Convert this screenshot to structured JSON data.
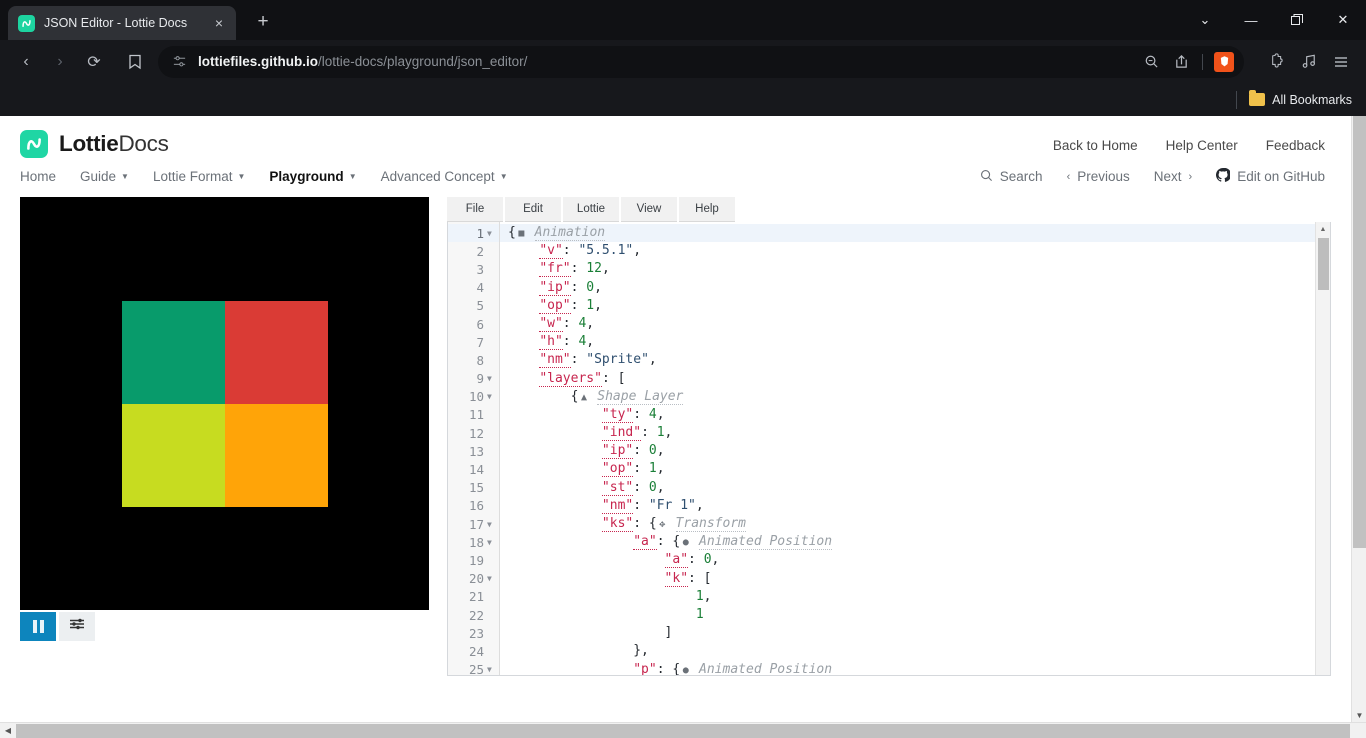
{
  "browser": {
    "name": "Brave",
    "tab": {
      "title": "JSON Editor - Lottie Docs",
      "favicon": "lottie-logo-icon",
      "close": "×"
    },
    "new_tab_label": "+",
    "window_controls": {
      "minimize": "—",
      "maximize": "❐",
      "close": "✕",
      "tab_search": "⌄"
    },
    "nav": {
      "back": "‹",
      "forward": "›",
      "reload": "⟳",
      "bookmark": "☆"
    },
    "url": {
      "domain": "lottiefiles.github.io",
      "path": "/lottie-docs/playground/json_editor/"
    },
    "url_actions": {
      "zoom_out": "zoom-out-icon",
      "share": "share-icon",
      "shield": "brave-shields-icon",
      "shield_glyph": "🦁"
    },
    "toolbar_right": {
      "extensions": "extensions-icon",
      "music": "music-icon",
      "menu": "hamburger-menu-icon"
    },
    "bookmarks_bar": {
      "all_bookmarks": "All Bookmarks"
    }
  },
  "site": {
    "logo": {
      "bold": "Lottie",
      "normal": "Docs"
    },
    "header_links": [
      "Back to Home",
      "Help Center",
      "Feedback"
    ],
    "nav_left": [
      {
        "label": "Home",
        "caret": false,
        "active": false
      },
      {
        "label": "Guide",
        "caret": true,
        "active": false
      },
      {
        "label": "Lottie Format",
        "caret": true,
        "active": false
      },
      {
        "label": "Playground",
        "caret": true,
        "active": true
      },
      {
        "label": "Advanced Concept",
        "caret": true,
        "active": false
      }
    ],
    "nav_right": [
      {
        "label": "Search",
        "icon": "search-icon"
      },
      {
        "label": "Previous",
        "icon": "chevron-left-icon"
      },
      {
        "label": "Next",
        "icon": "chevron-right-icon"
      },
      {
        "label": "Edit on GitHub",
        "icon": "github-icon"
      }
    ]
  },
  "preview": {
    "background": "#000000",
    "quadrants": [
      {
        "name": "top-left",
        "color": "#089b6b"
      },
      {
        "name": "top-right",
        "color": "#da3b35"
      },
      {
        "name": "bottom-left",
        "color": "#c7dc20"
      },
      {
        "name": "bottom-right",
        "color": "#ffa408"
      }
    ],
    "controls": {
      "pause": {
        "name": "pause-button",
        "color": "#0d85bd"
      },
      "settings": {
        "name": "playback-settings-button",
        "glyph": "☲"
      }
    }
  },
  "editor": {
    "menus": [
      "File",
      "Edit",
      "Lottie",
      "View",
      "Help"
    ],
    "active_line": 1,
    "lines": [
      {
        "n": 1,
        "fold": true,
        "indent": 0,
        "tokens": [
          {
            "t": "p",
            "v": "{"
          },
          {
            "t": "badge",
            "v": "■"
          },
          {
            "t": "lbl",
            "v": "Animation"
          }
        ]
      },
      {
        "n": 2,
        "fold": false,
        "indent": 1,
        "tokens": [
          {
            "t": "k",
            "v": "\"v\""
          },
          {
            "t": "p",
            "v": ": "
          },
          {
            "t": "s",
            "v": "\"5.5.1\""
          },
          {
            "t": "p",
            "v": ","
          }
        ]
      },
      {
        "n": 3,
        "fold": false,
        "indent": 1,
        "tokens": [
          {
            "t": "k",
            "v": "\"fr\""
          },
          {
            "t": "p",
            "v": ": "
          },
          {
            "t": "n",
            "v": "12"
          },
          {
            "t": "p",
            "v": ","
          }
        ]
      },
      {
        "n": 4,
        "fold": false,
        "indent": 1,
        "tokens": [
          {
            "t": "k",
            "v": "\"ip\""
          },
          {
            "t": "p",
            "v": ": "
          },
          {
            "t": "n",
            "v": "0"
          },
          {
            "t": "p",
            "v": ","
          }
        ]
      },
      {
        "n": 5,
        "fold": false,
        "indent": 1,
        "tokens": [
          {
            "t": "k",
            "v": "\"op\""
          },
          {
            "t": "p",
            "v": ": "
          },
          {
            "t": "n",
            "v": "1"
          },
          {
            "t": "p",
            "v": ","
          }
        ]
      },
      {
        "n": 6,
        "fold": false,
        "indent": 1,
        "tokens": [
          {
            "t": "k",
            "v": "\"w\""
          },
          {
            "t": "p",
            "v": ": "
          },
          {
            "t": "n",
            "v": "4"
          },
          {
            "t": "p",
            "v": ","
          }
        ]
      },
      {
        "n": 7,
        "fold": false,
        "indent": 1,
        "tokens": [
          {
            "t": "k",
            "v": "\"h\""
          },
          {
            "t": "p",
            "v": ": "
          },
          {
            "t": "n",
            "v": "4"
          },
          {
            "t": "p",
            "v": ","
          }
        ]
      },
      {
        "n": 8,
        "fold": false,
        "indent": 1,
        "tokens": [
          {
            "t": "k",
            "v": "\"nm\""
          },
          {
            "t": "p",
            "v": ": "
          },
          {
            "t": "s",
            "v": "\"Sprite\""
          },
          {
            "t": "p",
            "v": ","
          }
        ]
      },
      {
        "n": 9,
        "fold": true,
        "indent": 1,
        "tokens": [
          {
            "t": "k",
            "v": "\"layers\""
          },
          {
            "t": "p",
            "v": ": ["
          }
        ]
      },
      {
        "n": 10,
        "fold": true,
        "indent": 2,
        "tokens": [
          {
            "t": "p",
            "v": "{"
          },
          {
            "t": "badge",
            "v": "▲"
          },
          {
            "t": "lbl",
            "v": "Shape Layer"
          }
        ]
      },
      {
        "n": 11,
        "fold": false,
        "indent": 3,
        "tokens": [
          {
            "t": "k",
            "v": "\"ty\""
          },
          {
            "t": "p",
            "v": ": "
          },
          {
            "t": "n",
            "v": "4"
          },
          {
            "t": "p",
            "v": ","
          }
        ]
      },
      {
        "n": 12,
        "fold": false,
        "indent": 3,
        "tokens": [
          {
            "t": "k",
            "v": "\"ind\""
          },
          {
            "t": "p",
            "v": ": "
          },
          {
            "t": "n",
            "v": "1"
          },
          {
            "t": "p",
            "v": ","
          }
        ]
      },
      {
        "n": 13,
        "fold": false,
        "indent": 3,
        "tokens": [
          {
            "t": "k",
            "v": "\"ip\""
          },
          {
            "t": "p",
            "v": ": "
          },
          {
            "t": "n",
            "v": "0"
          },
          {
            "t": "p",
            "v": ","
          }
        ]
      },
      {
        "n": 14,
        "fold": false,
        "indent": 3,
        "tokens": [
          {
            "t": "k",
            "v": "\"op\""
          },
          {
            "t": "p",
            "v": ": "
          },
          {
            "t": "n",
            "v": "1"
          },
          {
            "t": "p",
            "v": ","
          }
        ]
      },
      {
        "n": 15,
        "fold": false,
        "indent": 3,
        "tokens": [
          {
            "t": "k",
            "v": "\"st\""
          },
          {
            "t": "p",
            "v": ": "
          },
          {
            "t": "n",
            "v": "0"
          },
          {
            "t": "p",
            "v": ","
          }
        ]
      },
      {
        "n": 16,
        "fold": false,
        "indent": 3,
        "tokens": [
          {
            "t": "k",
            "v": "\"nm\""
          },
          {
            "t": "p",
            "v": ": "
          },
          {
            "t": "s",
            "v": "\"Fr 1\""
          },
          {
            "t": "p",
            "v": ","
          }
        ]
      },
      {
        "n": 17,
        "fold": true,
        "indent": 3,
        "tokens": [
          {
            "t": "k",
            "v": "\"ks\""
          },
          {
            "t": "p",
            "v": ": {"
          },
          {
            "t": "badge",
            "v": "✥"
          },
          {
            "t": "lbl",
            "v": "Transform"
          }
        ]
      },
      {
        "n": 18,
        "fold": true,
        "indent": 4,
        "tokens": [
          {
            "t": "k",
            "v": "\"a\""
          },
          {
            "t": "p",
            "v": ": {"
          },
          {
            "t": "badge",
            "v": "●"
          },
          {
            "t": "lbl",
            "v": "Animated Position"
          }
        ]
      },
      {
        "n": 19,
        "fold": false,
        "indent": 5,
        "tokens": [
          {
            "t": "k",
            "v": "\"a\""
          },
          {
            "t": "p",
            "v": ": "
          },
          {
            "t": "n",
            "v": "0"
          },
          {
            "t": "p",
            "v": ","
          }
        ]
      },
      {
        "n": 20,
        "fold": true,
        "indent": 5,
        "tokens": [
          {
            "t": "k",
            "v": "\"k\""
          },
          {
            "t": "p",
            "v": ": ["
          }
        ]
      },
      {
        "n": 21,
        "fold": false,
        "indent": 6,
        "tokens": [
          {
            "t": "n",
            "v": "1"
          },
          {
            "t": "p",
            "v": ","
          }
        ]
      },
      {
        "n": 22,
        "fold": false,
        "indent": 6,
        "tokens": [
          {
            "t": "n",
            "v": "1"
          }
        ]
      },
      {
        "n": 23,
        "fold": false,
        "indent": 5,
        "tokens": [
          {
            "t": "p",
            "v": "]"
          }
        ]
      },
      {
        "n": 24,
        "fold": false,
        "indent": 4,
        "tokens": [
          {
            "t": "p",
            "v": "},"
          }
        ]
      },
      {
        "n": 25,
        "fold": true,
        "indent": 4,
        "tokens": [
          {
            "t": "k",
            "v": "\"p\""
          },
          {
            "t": "p",
            "v": ": {"
          },
          {
            "t": "badge",
            "v": "●"
          },
          {
            "t": "lbl",
            "v": "Animated Position"
          }
        ]
      }
    ]
  },
  "scrollbars": {
    "editor_vertical": "editor-vertical-scrollbar",
    "page_vertical": "page-vertical-scrollbar",
    "page_horizontal": "page-horizontal-scrollbar",
    "up_arrow": "▲",
    "down_arrow": "▼",
    "left_arrow": "◀"
  }
}
